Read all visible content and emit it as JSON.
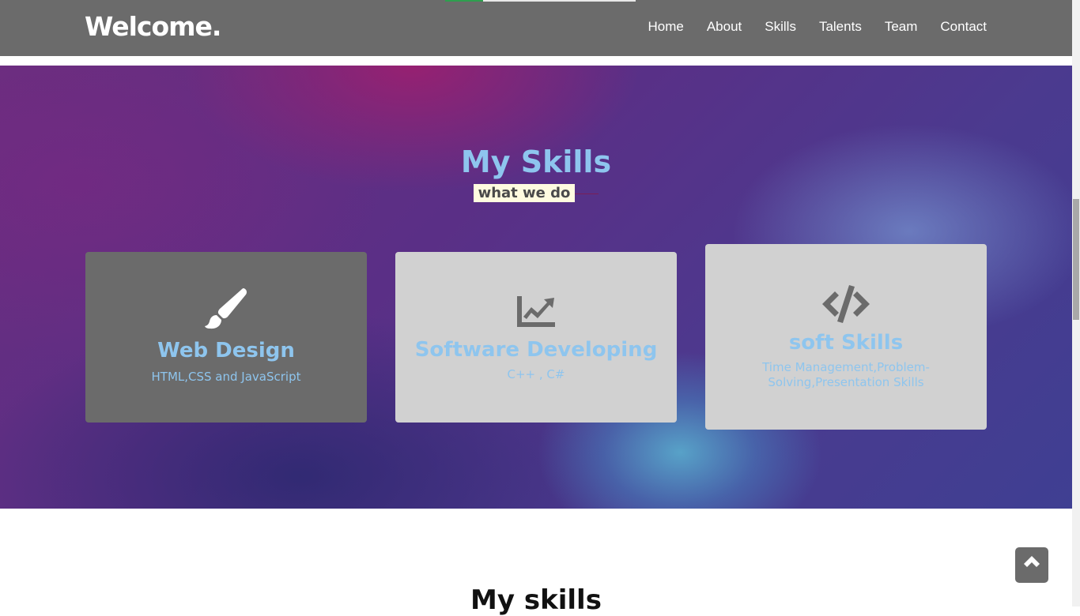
{
  "progress": {
    "fraction": 0.2
  },
  "navbar": {
    "brand": "Welcome.",
    "links": [
      "Home",
      "About",
      "Skills",
      "Talents",
      "Team",
      "Contact"
    ]
  },
  "skills": {
    "title": "My Skills",
    "subtitle": "what we do",
    "cards": [
      {
        "icon": "paint-brush-icon",
        "title": "Web Design",
        "description": "HTML,CSS and JavaScript"
      },
      {
        "icon": "chart-line-icon",
        "title": "Software Developing",
        "description": "C++ , C#"
      },
      {
        "icon": "code-icon",
        "title": "soft Skills",
        "description": "Time Management,Problem-Solving,Presentation Skills"
      }
    ]
  },
  "next_section": {
    "title": "My skills"
  },
  "back_to_top": {
    "icon": "chevron-up-icon"
  },
  "colors": {
    "navbar": "#6b6b6b",
    "accent": "#8ec5ee",
    "card_dark": "#6b6b6b",
    "card_light": "#d1d1d1"
  }
}
